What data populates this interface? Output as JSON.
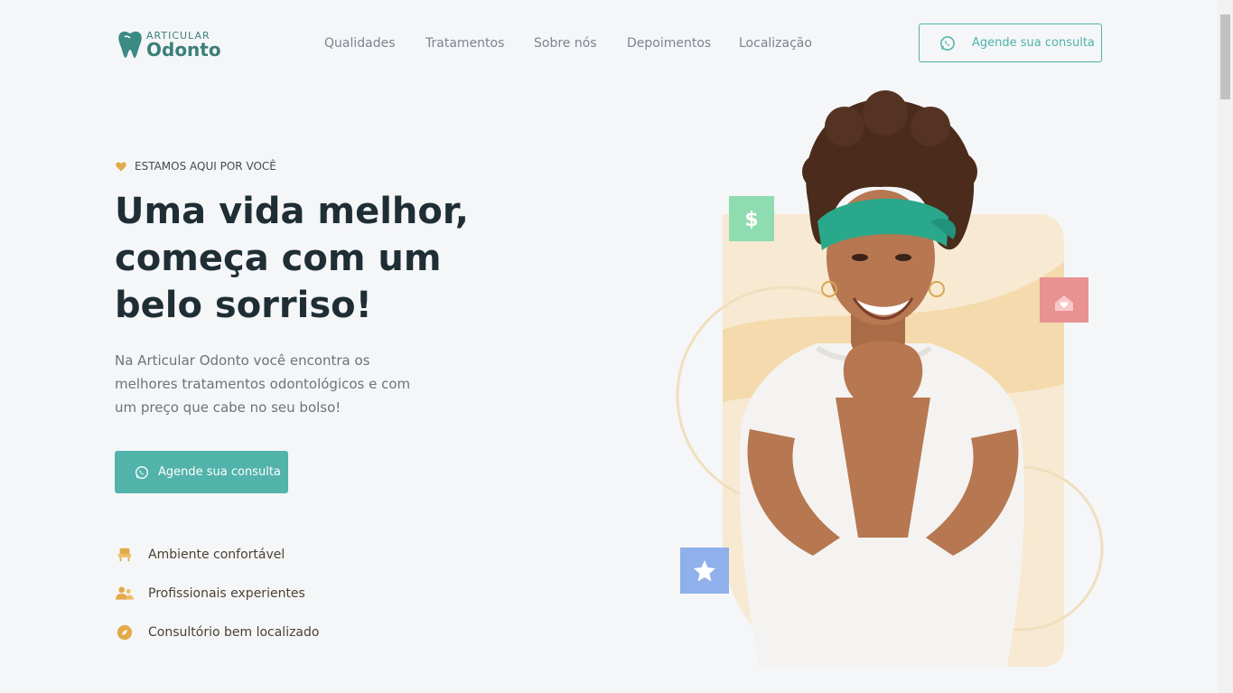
{
  "logo": {
    "top": "ARTICULAR",
    "bottom": "Odonto"
  },
  "nav": {
    "items": [
      {
        "label": "Qualidades"
      },
      {
        "label": "Tratamentos"
      },
      {
        "label": "Sobre nós"
      },
      {
        "label": "Depoimentos"
      },
      {
        "label": "Localização"
      }
    ],
    "cta_label": "Agende sua consulta"
  },
  "hero": {
    "tagline": "ESTAMOS AQUI POR VOCÊ",
    "title": "Uma vida melhor, começa com um belo sorriso!",
    "lead": "Na Articular Odonto você encontra os melhores tratamentos odontológicos e com um preço que cabe no seu bolso!",
    "cta_label": "Agende sua consulta",
    "features": [
      {
        "label": "Ambiente confortável",
        "icon": "chair-icon"
      },
      {
        "label": "Profissionais experientes",
        "icon": "users-icon"
      },
      {
        "label": "Consultório bem localizado",
        "icon": "compass-icon"
      }
    ],
    "badges": {
      "dollar": "$"
    }
  },
  "colors": {
    "accent": "#52b3ab",
    "dark": "#1f2e35",
    "gold": "#e3a94a"
  }
}
